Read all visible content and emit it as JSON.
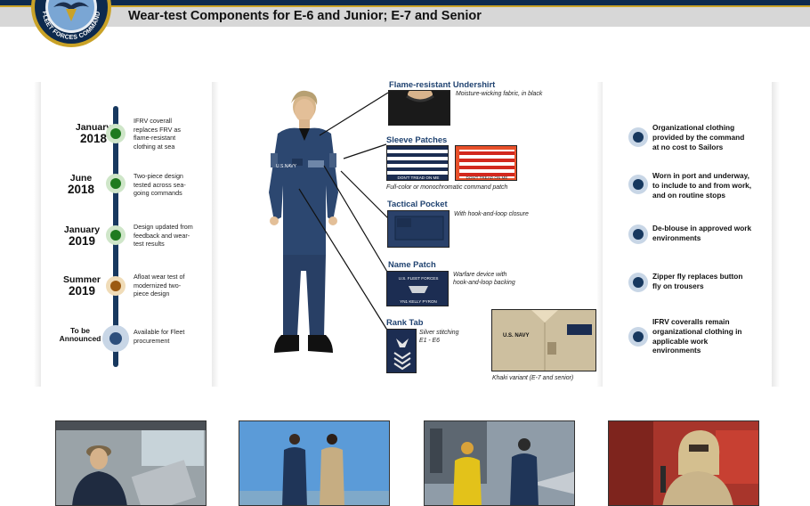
{
  "header": {
    "title": "Wear-test Components for E-6 and Junior; E-7 and Senior",
    "logo_text": "FLEET FORCES COMMAND"
  },
  "timeline": [
    {
      "month": "January",
      "year": "2018",
      "text": "IFRV coverall replaces FRV as flame-resistant clothing at sea",
      "color": "#1f7a1f"
    },
    {
      "month": "June",
      "year": "2018",
      "text": "Two-piece design tested across sea-going commands",
      "color": "#1f7a1f"
    },
    {
      "month": "January",
      "year": "2019",
      "text": "Design updated from feedback and wear-test results",
      "color": "#1f7a1f"
    },
    {
      "month": "Summer",
      "year": "2019",
      "text": "Afloat wear test of modernized two-piece design",
      "color": "#9b5a12"
    },
    {
      "month": "To be",
      "year": "Announced",
      "text": "Available for Fleet procurement",
      "color": "#2d4f7c"
    }
  ],
  "components": {
    "undershirt": {
      "label": "Flame-resistant Undershirt",
      "note": "Moisture-wicking fabric, in black"
    },
    "sleeve": {
      "label": "Sleeve Patches",
      "note": "Full-color or monochromatic command patch",
      "patch_text": "DON'T TREAD ON ME"
    },
    "pocket": {
      "label": "Tactical Pocket",
      "note": "With hook-and-loop closure"
    },
    "name_patch": {
      "label": "Name Patch",
      "note_line1": "Warfare device with",
      "note_line2": "hook-and-loop backing",
      "patch_line1": "U.S. FLEET FORCES",
      "patch_line2": "YN1 KELLY PYRON"
    },
    "rank_tab": {
      "label": "Rank Tab",
      "note_line1": "Silver stitching",
      "note_line2": "E1 - E6"
    },
    "khaki": {
      "note": "Khaki variant (E-7 and senior)",
      "tape": "U.S. NAVY"
    }
  },
  "sailor": {
    "tape": "U.S.NAVY"
  },
  "facts": [
    "Organizational clothing provided by the command at no cost to Sailors",
    "Worn in port and underway, to include to and from work, and on routine stops",
    "De-blouse in approved work environments",
    "Zipper fly replaces button fly on trousers",
    "IFRV coveralls remain organizational clothing in applicable work environments"
  ],
  "colors": {
    "navy": "#17385f",
    "label_blue": "#1f4270",
    "gold": "#c9a227",
    "header_gray": "#d7d7d7"
  },
  "photos": [
    "bridge-sailor-photo",
    "flight-deck-pair-photo",
    "carrier-deck-photo",
    "fire-gear-photo"
  ]
}
